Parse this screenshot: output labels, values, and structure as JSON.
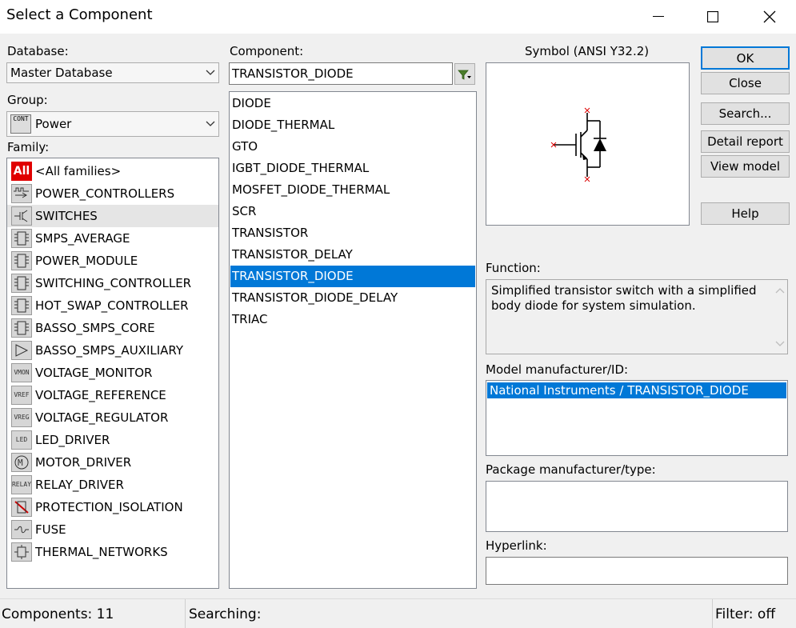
{
  "window": {
    "title": "Select a Component"
  },
  "left": {
    "database_label": "Database:",
    "database_value": "Master Database",
    "group_label": "Group:",
    "group_icon": "CONT",
    "group_value": "Power",
    "family_label": "Family:",
    "families": [
      {
        "label": "<All families>",
        "icon": "All"
      },
      {
        "label": "POWER_CONTROLLERS",
        "icon": "pulse"
      },
      {
        "label": "SWITCHES",
        "icon": "switch"
      },
      {
        "label": "SMPS_AVERAGE",
        "icon": "ic"
      },
      {
        "label": "POWER_MODULE",
        "icon": "ic"
      },
      {
        "label": "SWITCHING_CONTROLLER",
        "icon": "ic"
      },
      {
        "label": "HOT_SWAP_CONTROLLER",
        "icon": "ic"
      },
      {
        "label": "BASSO_SMPS_CORE",
        "icon": "ic"
      },
      {
        "label": "BASSO_SMPS_AUXILIARY",
        "icon": "amp"
      },
      {
        "label": "VOLTAGE_MONITOR",
        "icon": "VMON"
      },
      {
        "label": "VOLTAGE_REFERENCE",
        "icon": "VREF"
      },
      {
        "label": "VOLTAGE_REGULATOR",
        "icon": "VREG"
      },
      {
        "label": "LED_DRIVER",
        "icon": "LED"
      },
      {
        "label": "MOTOR_DRIVER",
        "icon": "M"
      },
      {
        "label": "RELAY_DRIVER",
        "icon": "RELAY"
      },
      {
        "label": "PROTECTION_ISOLATION",
        "icon": "prot"
      },
      {
        "label": "FUSE",
        "icon": "fuse"
      },
      {
        "label": "THERMAL_NETWORKS",
        "icon": "therm"
      }
    ]
  },
  "middle": {
    "component_label": "Component:",
    "component_value": "TRANSISTOR_DIODE",
    "components": [
      "DIODE",
      "DIODE_THERMAL",
      "GTO",
      "IGBT_DIODE_THERMAL",
      "MOSFET_DIODE_THERMAL",
      "SCR",
      "TRANSISTOR",
      "TRANSISTOR_DELAY",
      "TRANSISTOR_DIODE",
      "TRANSISTOR_DIODE_DELAY",
      "TRIAC"
    ]
  },
  "right": {
    "symbol_label": "Symbol (ANSI Y32.2)",
    "function_label": "Function:",
    "function_text": "Simplified transistor switch with a simplified body diode for system simulation.",
    "model_label": "Model manufacturer/ID:",
    "model_value": "National Instruments / TRANSISTOR_DIODE",
    "package_label": "Package manufacturer/type:",
    "hyperlink_label": "Hyperlink:"
  },
  "buttons": {
    "ok": "OK",
    "close": "Close",
    "search": "Search...",
    "detail_report": "Detail report",
    "view_model": "View model",
    "help": "Help"
  },
  "status": {
    "components": "Components: 11",
    "searching": "Searching:",
    "filter": "Filter: off"
  },
  "colors": {
    "selection": "#0078d7",
    "all_icon": "#e00000"
  }
}
